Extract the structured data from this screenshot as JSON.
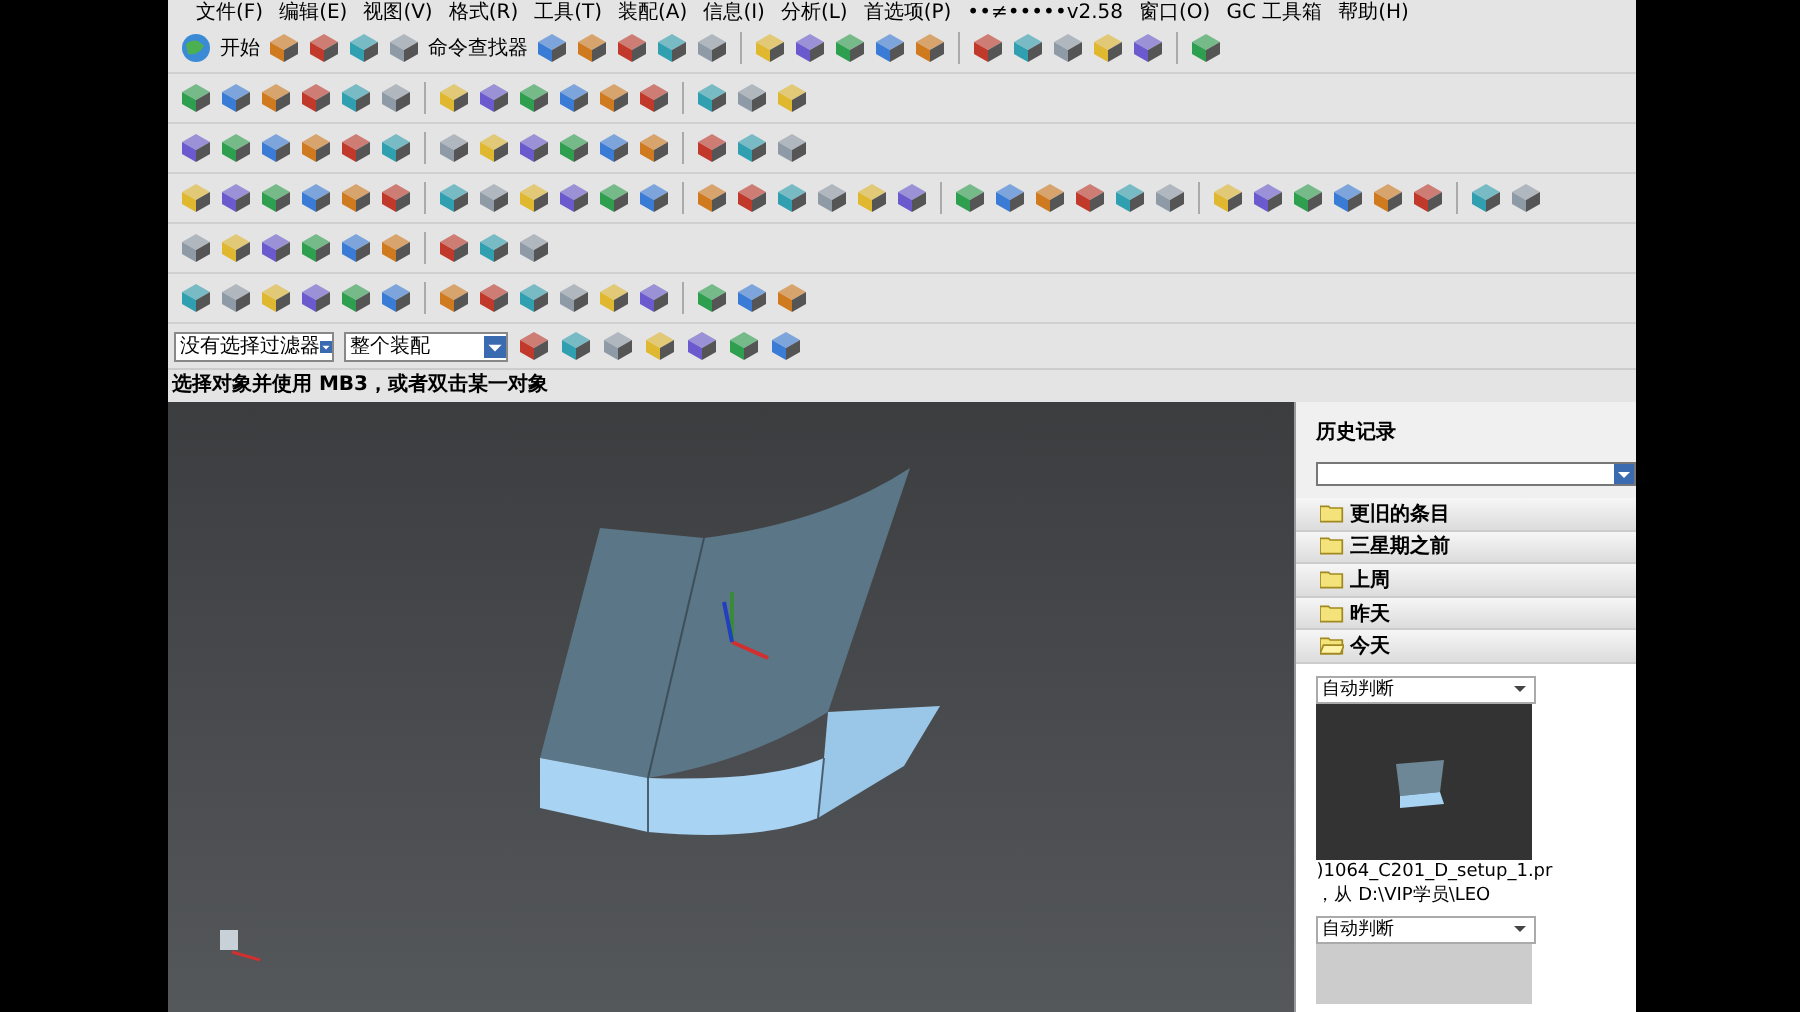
{
  "menu": [
    "文件(F)",
    "编辑(E)",
    "视图(V)",
    "格式(R)",
    "工具(T)",
    "装配(A)",
    "信息(I)",
    "分析(L)",
    "首选项(P)",
    "••≠•••••v2.58",
    "窗口(O)",
    "GC 工具箱",
    "帮助(H)"
  ],
  "toolbar": {
    "start_label": "开始",
    "finder_label": "命令查找器"
  },
  "selection_bar": {
    "type_filter": "没有选择过滤器",
    "scope": "整个装配"
  },
  "prompt": "选择对象并使用 MB3，或者双击某一对象",
  "history": {
    "title": "历史记录",
    "groups": [
      {
        "label": "更旧的条目",
        "expanded": false
      },
      {
        "label": "三星期之前",
        "expanded": false
      },
      {
        "label": "上周",
        "expanded": false
      },
      {
        "label": "昨天",
        "expanded": false
      },
      {
        "label": "今天",
        "expanded": true
      }
    ],
    "entries": [
      {
        "filter": "自动判断",
        "file": ")1064_C201_D_setup_1.pr",
        "location": "，从 D:\\VIP学员\\LEO"
      },
      {
        "filter": "自动判断"
      }
    ]
  }
}
